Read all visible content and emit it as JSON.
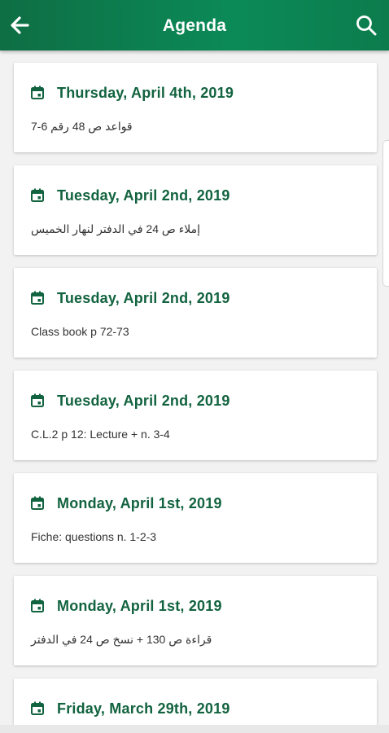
{
  "header": {
    "title": "Agenda",
    "back_icon": "arrow-left-icon",
    "search_icon": "search-icon"
  },
  "colors": {
    "primary": "#0b8a57",
    "date_text": "#12633f"
  },
  "entries": [
    {
      "date": "Thursday, April 4th, 2019",
      "description": "قواعد ص 48 رقم 6-7"
    },
    {
      "date": "Tuesday, April 2nd, 2019",
      "description": "إملاء ص 24 في الدفتر لنهار الخميس"
    },
    {
      "date": "Tuesday, April 2nd, 2019",
      "description": "Class book p 72-73"
    },
    {
      "date": "Tuesday, April 2nd, 2019",
      "description": "C.L.2 p 12: Lecture + n. 3-4"
    },
    {
      "date": "Monday, April 1st, 2019",
      "description": "Fiche: questions n. 1-2-3"
    },
    {
      "date": "Monday, April 1st, 2019",
      "description": "قراءة ص 130 + نسخ ص 24 في الدفتر"
    },
    {
      "date": "Friday, March 29th, 2019",
      "description": ""
    }
  ]
}
